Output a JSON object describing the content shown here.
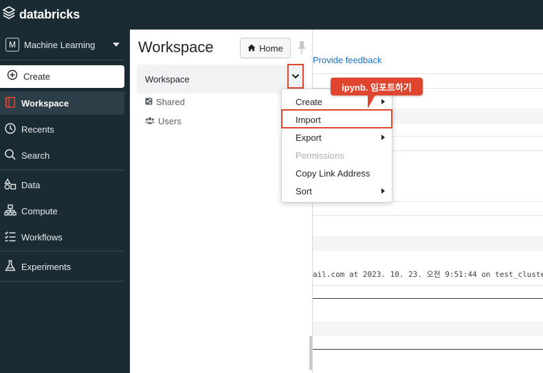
{
  "app": {
    "brand": "databricks"
  },
  "sidebar": {
    "persona": {
      "badge": "M",
      "label": "Machine Learning"
    },
    "create_label": "Create",
    "items": [
      {
        "label": "Workspace",
        "icon": "workspace-icon",
        "active": true
      },
      {
        "label": "Recents",
        "icon": "clock-icon"
      },
      {
        "label": "Search",
        "icon": "search-icon"
      },
      {
        "label": "Data",
        "icon": "data-icon"
      },
      {
        "label": "Compute",
        "icon": "compute-icon"
      },
      {
        "label": "Workflows",
        "icon": "workflows-icon"
      },
      {
        "label": "Experiments",
        "icon": "flask-icon"
      }
    ]
  },
  "workspace_panel": {
    "title": "Workspace",
    "home_label": "Home",
    "selected_folder": "Workspace",
    "tree": [
      {
        "label": "Shared",
        "icon": "shared-folder-icon"
      },
      {
        "label": "Users",
        "icon": "users-icon"
      }
    ]
  },
  "context_menu": {
    "items": [
      {
        "label": "Create",
        "submenu": true,
        "disabled": false
      },
      {
        "label": "Import",
        "submenu": false,
        "disabled": false,
        "highlighted": true
      },
      {
        "label": "Export",
        "submenu": true,
        "disabled": false
      },
      {
        "label": "Permissions",
        "submenu": false,
        "disabled": true
      },
      {
        "label": "Copy Link Address",
        "submenu": false,
        "disabled": false
      },
      {
        "label": "Sort",
        "submenu": true,
        "disabled": false
      }
    ]
  },
  "annotation": {
    "callout_text": "ipynb. 임포트하기",
    "color": "#e0452f"
  },
  "background": {
    "feedback_link": "Provide feedback",
    "run_info": "ail.com at 2023. 10. 23. 오전 9:51:44 on test_cluste"
  },
  "colors": {
    "sidebar_bg": "#1b2b34",
    "accent_red": "#e0452f",
    "link_blue": "#1a73c9"
  }
}
